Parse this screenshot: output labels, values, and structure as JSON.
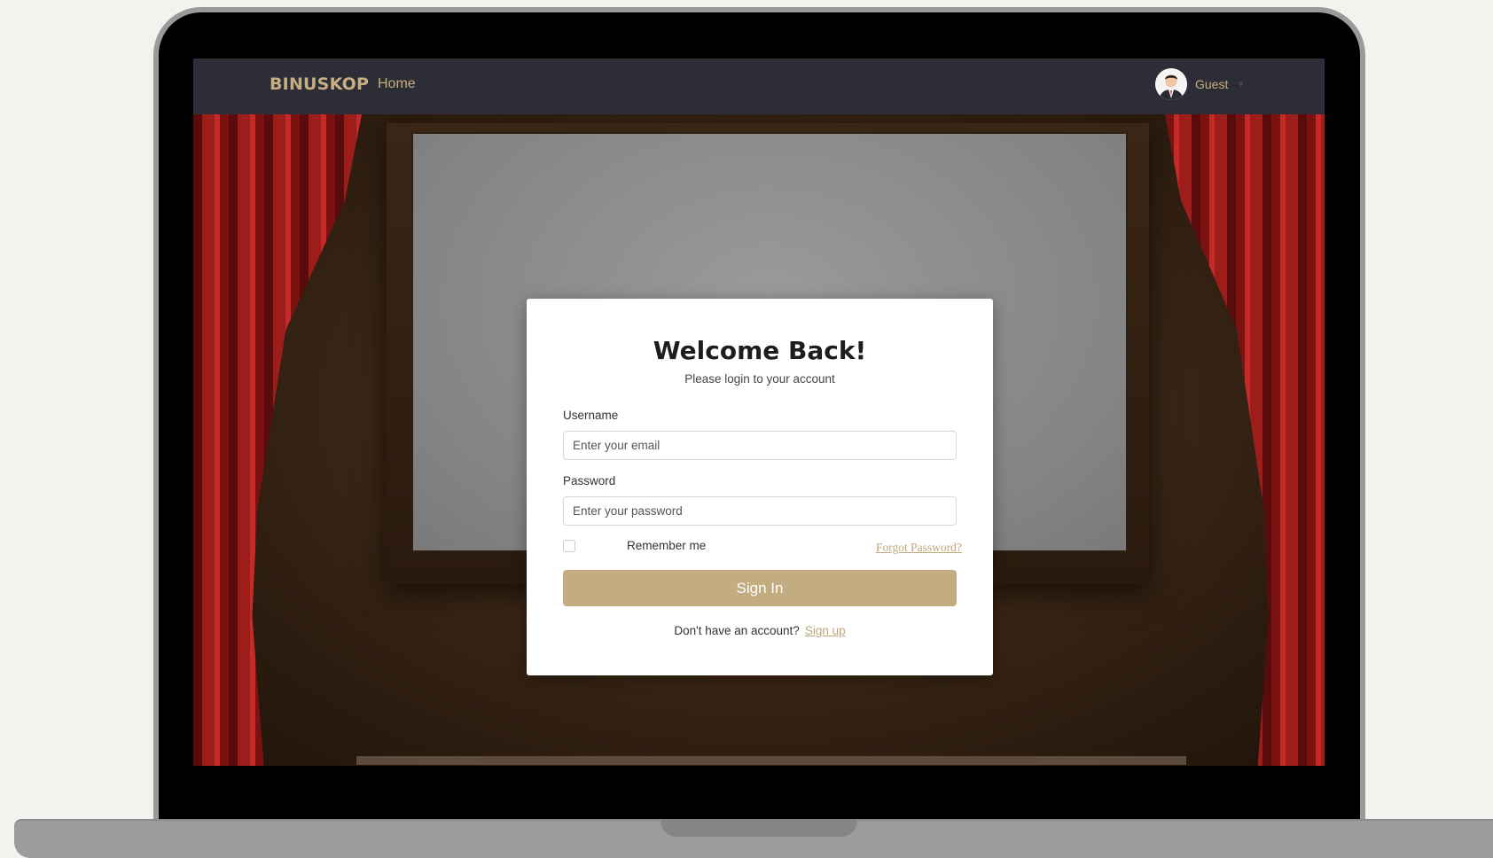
{
  "navbar": {
    "brand": "BINUSKOP",
    "home_label": "Home",
    "user_name": "Guest"
  },
  "login": {
    "title": "Welcome Back!",
    "subtitle": "Please login to your account",
    "username_label": "Username",
    "username_placeholder": "Enter your email",
    "username_value": "",
    "password_label": "Password",
    "password_placeholder": "Enter your password",
    "password_value": "",
    "remember_label": "Remember me",
    "remember_checked": false,
    "forgot_label": "Forgot Password?",
    "signin_label": "Sign In",
    "signup_prompt": "Don't have an account?",
    "signup_label": "Sign up"
  },
  "colors": {
    "navbar_bg": "#2c2d36",
    "accent_gold": "#c3ac7f",
    "curtain_red": "#9d1d1b",
    "card_bg": "#ffffff"
  },
  "icons": {
    "avatar": "user-avatar-icon",
    "user_menu": "chevron-down-icon"
  }
}
